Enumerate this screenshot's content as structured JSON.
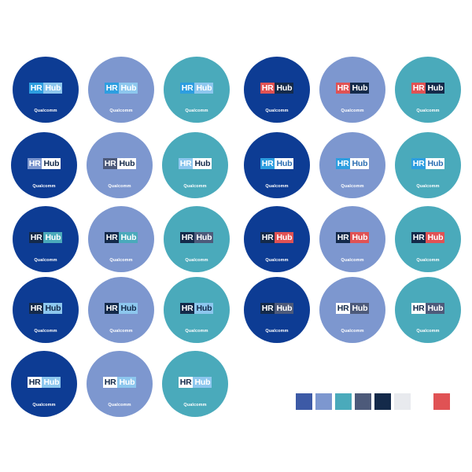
{
  "brand_text": "Qualcomm",
  "logo": {
    "hr": "HR",
    "hub": "Hub"
  },
  "palette": {
    "navy": "#0d3c94",
    "periwinkle": "#7d97cf",
    "teal": "#4aaabb",
    "light_blue": "#2d9ee0",
    "sky": "#8dc7ee",
    "dark": "#142a4a",
    "slate": "#4d5a7a",
    "red": "#e05254",
    "white": "#ffffff"
  },
  "badges": [
    {
      "bg": "#0d3c94",
      "hr_bg": "#2d9ee0",
      "hr_fg": "#ffffff",
      "hub_bg": "#8dc7ee",
      "hub_fg": "#ffffff"
    },
    {
      "bg": "#7d97cf",
      "hr_bg": "#2d9ee0",
      "hr_fg": "#ffffff",
      "hub_bg": "#8dc7ee",
      "hub_fg": "#ffffff"
    },
    {
      "bg": "#4aaabb",
      "hr_bg": "#2d9ee0",
      "hr_fg": "#ffffff",
      "hub_bg": "#8dc7ee",
      "hub_fg": "#ffffff"
    },
    {
      "bg": "#0d3c94",
      "hr_bg": "#e05254",
      "hr_fg": "#ffffff",
      "hub_bg": "#142a4a",
      "hub_fg": "#ffffff"
    },
    {
      "bg": "#7d97cf",
      "hr_bg": "#e05254",
      "hr_fg": "#ffffff",
      "hub_bg": "#142a4a",
      "hub_fg": "#ffffff"
    },
    {
      "bg": "#4aaabb",
      "hr_bg": "#e05254",
      "hr_fg": "#ffffff",
      "hub_bg": "#142a4a",
      "hub_fg": "#ffffff"
    },
    {
      "bg": "#0d3c94",
      "hr_bg": "#7d97cf",
      "hr_fg": "#ffffff",
      "hub_bg": "#ffffff",
      "hub_fg": "#142a4a"
    },
    {
      "bg": "#7d97cf",
      "hr_bg": "#4d5a7a",
      "hr_fg": "#ffffff",
      "hub_bg": "#ffffff",
      "hub_fg": "#142a4a"
    },
    {
      "bg": "#4aaabb",
      "hr_bg": "#8dc7ee",
      "hr_fg": "#ffffff",
      "hub_bg": "#ffffff",
      "hub_fg": "#142a4a"
    },
    {
      "bg": "#0d3c94",
      "hr_bg": "#2d9ee0",
      "hr_fg": "#ffffff",
      "hub_bg": "#ffffff",
      "hub_fg": "#2d6fb3"
    },
    {
      "bg": "#7d97cf",
      "hr_bg": "#2d9ee0",
      "hr_fg": "#ffffff",
      "hub_bg": "#ffffff",
      "hub_fg": "#2d6fb3"
    },
    {
      "bg": "#4aaabb",
      "hr_bg": "#2d9ee0",
      "hr_fg": "#ffffff",
      "hub_bg": "#ffffff",
      "hub_fg": "#2d6fb3"
    },
    {
      "bg": "#0d3c94",
      "hr_bg": "#142a4a",
      "hr_fg": "#ffffff",
      "hub_bg": "#4aaabb",
      "hub_fg": "#ffffff"
    },
    {
      "bg": "#7d97cf",
      "hr_bg": "#142a4a",
      "hr_fg": "#ffffff",
      "hub_bg": "#4aaabb",
      "hub_fg": "#ffffff"
    },
    {
      "bg": "#4aaabb",
      "hr_bg": "#142a4a",
      "hr_fg": "#ffffff",
      "hub_bg": "#4d5a7a",
      "hub_fg": "#ffffff"
    },
    {
      "bg": "#0d3c94",
      "hr_bg": "#142a4a",
      "hr_fg": "#ffffff",
      "hub_bg": "#e05254",
      "hub_fg": "#ffffff"
    },
    {
      "bg": "#7d97cf",
      "hr_bg": "#142a4a",
      "hr_fg": "#ffffff",
      "hub_bg": "#e05254",
      "hub_fg": "#ffffff"
    },
    {
      "bg": "#4aaabb",
      "hr_bg": "#142a4a",
      "hr_fg": "#ffffff",
      "hub_bg": "#e05254",
      "hub_fg": "#ffffff"
    },
    {
      "bg": "#0d3c94",
      "hr_bg": "#142a4a",
      "hr_fg": "#ffffff",
      "hub_bg": "#8dc7ee",
      "hub_fg": "#142a4a"
    },
    {
      "bg": "#7d97cf",
      "hr_bg": "#142a4a",
      "hr_fg": "#ffffff",
      "hub_bg": "#8dc7ee",
      "hub_fg": "#142a4a"
    },
    {
      "bg": "#4aaabb",
      "hr_bg": "#142a4a",
      "hr_fg": "#ffffff",
      "hub_bg": "#8dc7ee",
      "hub_fg": "#142a4a"
    },
    {
      "bg": "#0d3c94",
      "hr_bg": "#142a4a",
      "hr_fg": "#ffffff",
      "hub_bg": "#4d5a7a",
      "hub_fg": "#ffffff"
    },
    {
      "bg": "#7d97cf",
      "hr_bg": "#ffffff",
      "hr_fg": "#142a4a",
      "hub_bg": "#4d5a7a",
      "hub_fg": "#ffffff"
    },
    {
      "bg": "#4aaabb",
      "hr_bg": "#ffffff",
      "hr_fg": "#142a4a",
      "hub_bg": "#4d5a7a",
      "hub_fg": "#ffffff"
    },
    {
      "bg": "#0d3c94",
      "hr_bg": "#ffffff",
      "hr_fg": "#142a4a",
      "hub_bg": "#8dc7ee",
      "hub_fg": "#ffffff"
    },
    {
      "bg": "#7d97cf",
      "hr_bg": "#ffffff",
      "hr_fg": "#142a4a",
      "hub_bg": "#8dc7ee",
      "hub_fg": "#ffffff"
    },
    {
      "bg": "#4aaabb",
      "hr_bg": "#ffffff",
      "hr_fg": "#142a4a",
      "hub_bg": "#8dc7ee",
      "hub_fg": "#ffffff"
    }
  ],
  "swatches": [
    "#3d5aa6",
    "#7d97cf",
    "#4aaabb",
    "#4d5a7a",
    "#142a4a",
    "#e8eaee",
    "#e05254"
  ]
}
